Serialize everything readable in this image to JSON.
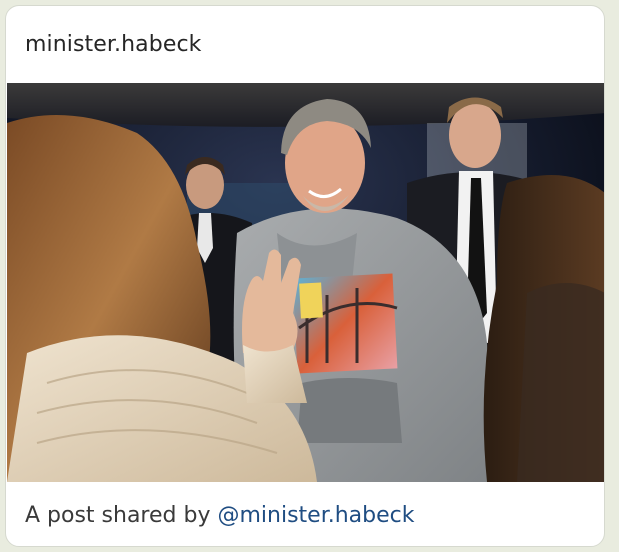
{
  "post": {
    "username": "minister.habeck",
    "caption_prefix": "A post shared by",
    "caption_handle": "@minister.habeck"
  },
  "colors": {
    "background": "#e9ecdf",
    "card": "#ffffff",
    "link": "#1f4d82",
    "text": "#262626"
  }
}
